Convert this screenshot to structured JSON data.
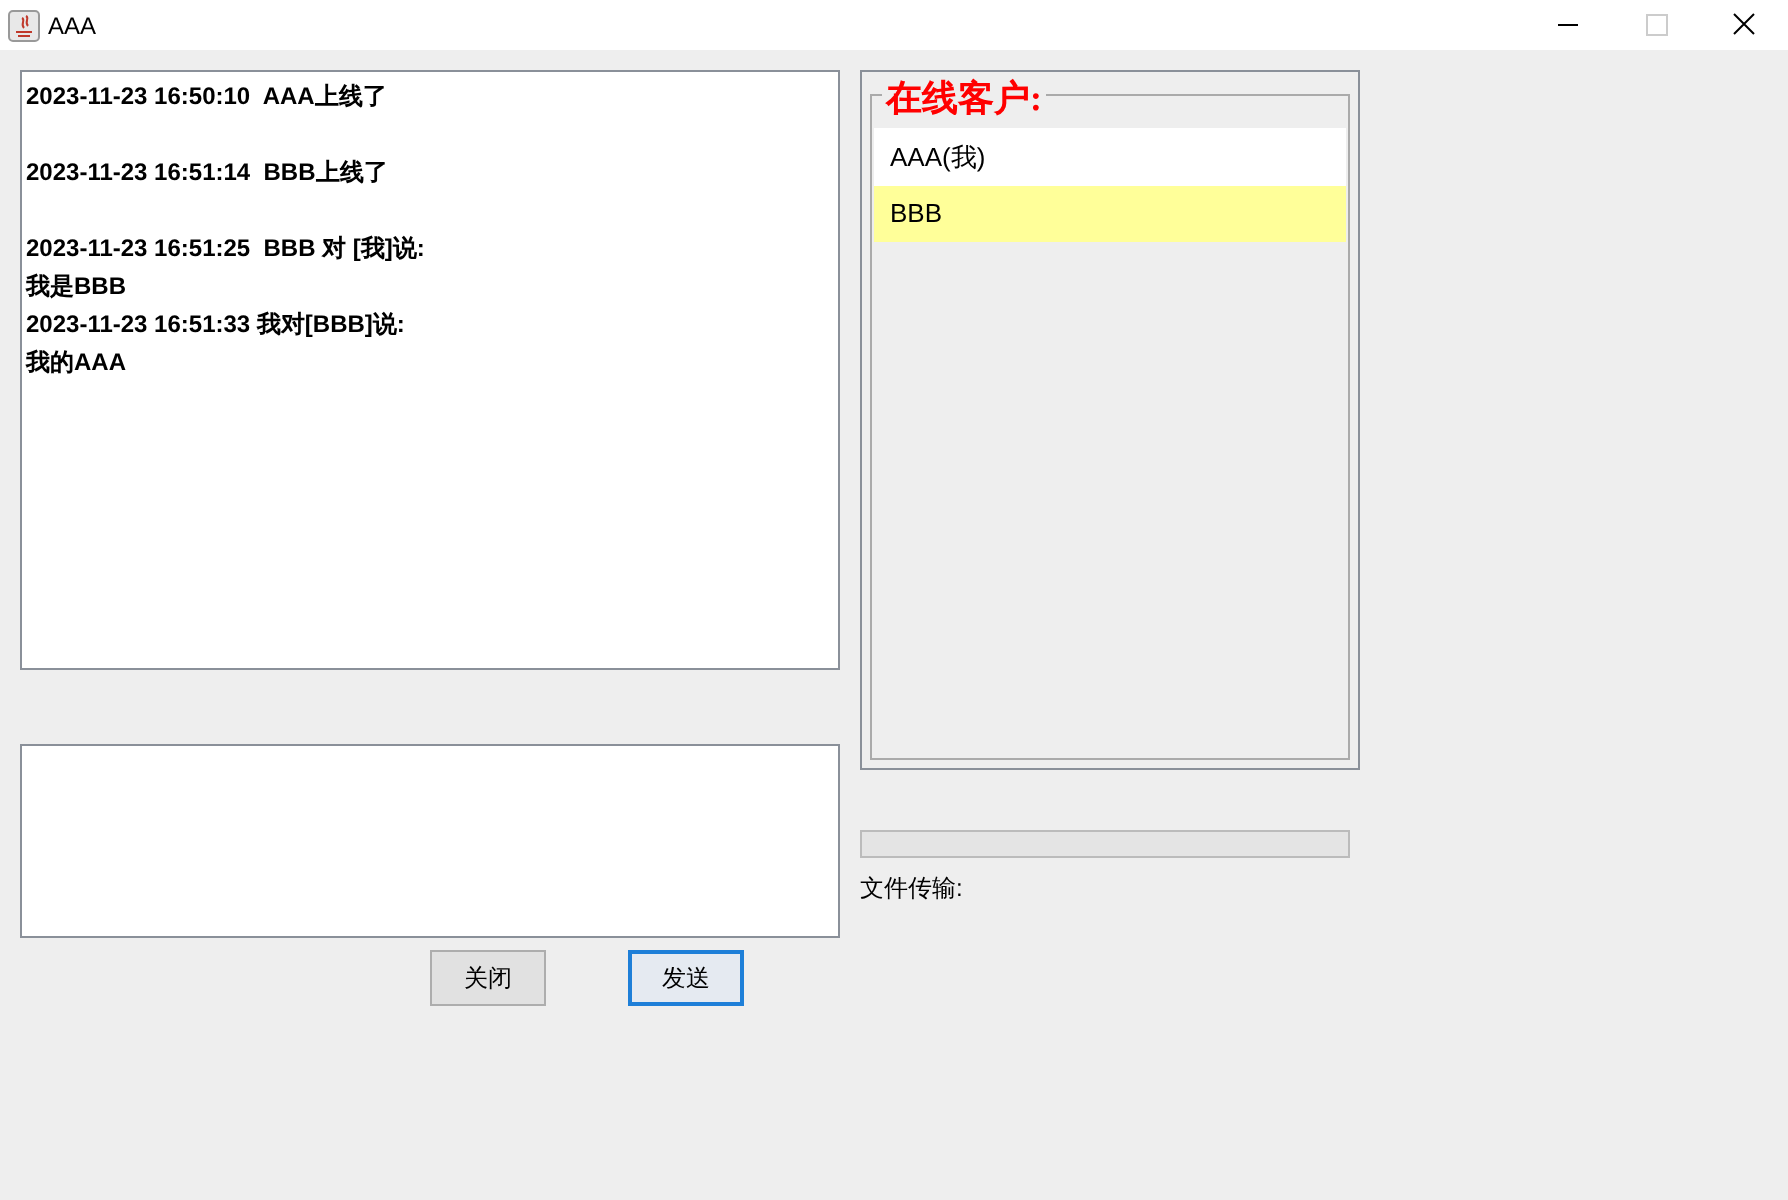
{
  "window": {
    "title": "AAA",
    "maximize_disabled": true
  },
  "chat_log": [
    {
      "text": "2023-11-23 16:50:10  AAA上线了",
      "blank_after": true
    },
    {
      "text": "2023-11-23 16:51:14  BBB上线了",
      "blank_after": true
    },
    {
      "text": "2023-11-23 16:51:25  BBB 对 [我]说:",
      "blank_after": false
    },
    {
      "text": "我是BBB",
      "blank_after": false
    },
    {
      "text": "2023-11-23 16:51:33 我对[BBB]说:",
      "blank_after": false
    },
    {
      "text": "我的AAA",
      "blank_after": false
    }
  ],
  "buttons": [
    {
      "label": "关闭",
      "focused": false
    },
    {
      "label": "发送",
      "focused": true
    }
  ],
  "online_panel": {
    "title": "在线客户:",
    "clients": [
      {
        "name": "AAA(我)",
        "selected": false
      },
      {
        "name": "BBB",
        "selected": true
      }
    ]
  },
  "file_transfer": {
    "level": 0,
    "label": "文件传输:"
  }
}
